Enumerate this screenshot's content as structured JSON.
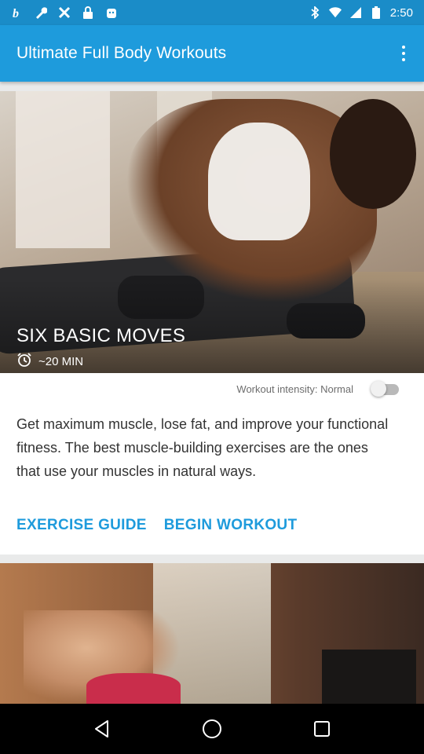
{
  "status_bar": {
    "time": "2:50",
    "left_icons": [
      "b-app-icon",
      "wrench-icon",
      "tools-icon",
      "lock-icon",
      "android-icon"
    ],
    "right_icons": [
      "bluetooth-icon",
      "wifi-icon",
      "signal-icon",
      "battery-icon"
    ]
  },
  "app_bar": {
    "title": "Ultimate Full Body Workouts",
    "menu_icon": "more-vert-icon"
  },
  "workout_card": {
    "title": "SIX BASIC MOVES",
    "duration": "~20 MIN",
    "duration_icon": "alarm-clock-icon",
    "intensity_label": "Workout intensity: Normal",
    "intensity_toggle_on": false,
    "description": "Get maximum muscle, lose fat, and improve your functional fitness. The best muscle-building exercises are the ones that use your muscles in natural ways.",
    "exercise_guide_label": "EXERCISE GUIDE",
    "begin_workout_label": "BEGIN WORKOUT"
  },
  "colors": {
    "status_bar": "#1a8cc8",
    "app_bar": "#1e9bdc",
    "accent": "#1e9bdc",
    "background": "#e9eaea"
  },
  "nav_bar": {
    "icons": [
      "back-icon",
      "home-icon",
      "recents-icon"
    ]
  }
}
